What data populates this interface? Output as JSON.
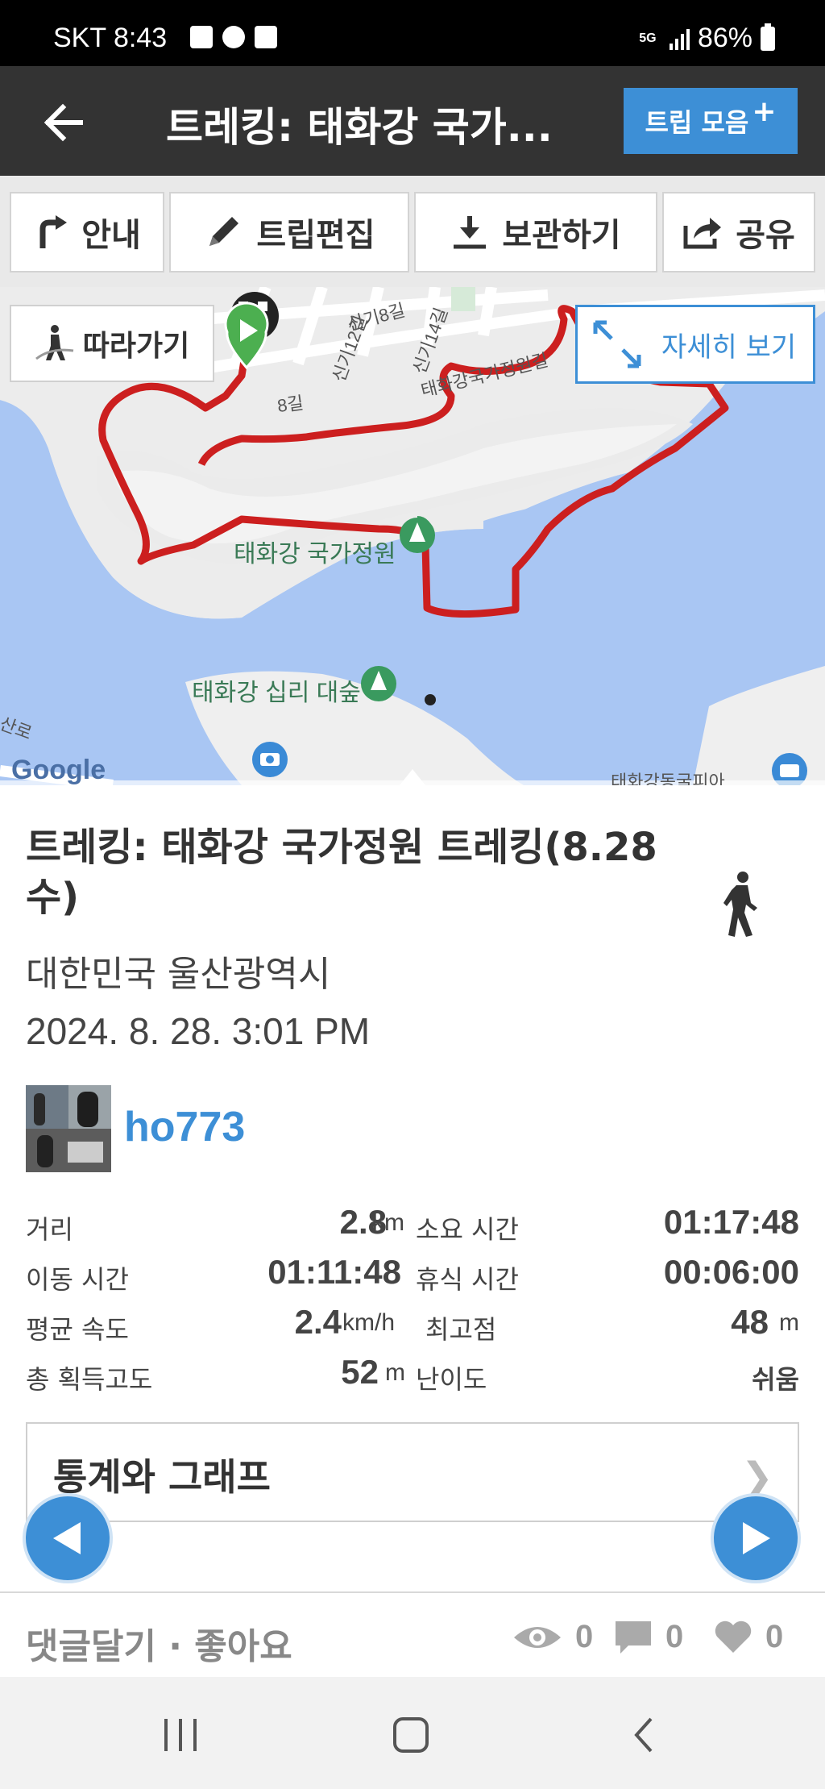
{
  "status_bar": {
    "carrier_time": "SKT 8:43",
    "network": "5G",
    "battery": "86%"
  },
  "header": {
    "title": "트레킹: 태화강 국가...",
    "trip_collection": "트립 모음"
  },
  "actions": {
    "guide": "안내",
    "edit": "트립편집",
    "save": "보관하기",
    "share": "공유"
  },
  "map": {
    "follow": "따라가기",
    "detail": "자세히 보기",
    "labels": {
      "garden": "태화강 국가정원",
      "forest": "태화강 십리 대숲",
      "road_garden": "태화강국가정원길",
      "road_sin8": "신기8길",
      "road_sin12": "신기12길",
      "road_sin14": "신기14길",
      "road_8gil": "8길",
      "road_left": "산로",
      "bottom_right": "태화강동굴피아"
    },
    "google": "Google"
  },
  "trip": {
    "title": "트레킹: 태화강 국가정원  트레킹(8.28 수)",
    "location": "대한민국 울산광역시",
    "datetime": "2024. 8. 28. 3:01 PM",
    "user": "ho773",
    "activity_icon": "walking-icon"
  },
  "stats": {
    "distance_label": "거리",
    "distance_value": "2.8",
    "distance_unit": "km",
    "duration_label": "소요 시간",
    "duration_value": "01:17:48",
    "moving_label": "이동 시간",
    "moving_value": "01:11:48",
    "rest_label": "휴식 시간",
    "rest_value": "00:06:00",
    "speed_label": "평균 속도",
    "speed_value": "2.4",
    "speed_unit": "km/h",
    "max_label": "최고점",
    "max_value": "48",
    "max_unit": "m",
    "gain_label": "총 획득고도",
    "gain_value": "52",
    "gain_unit": "m",
    "difficulty_label": "난이도",
    "difficulty_value": "쉬움"
  },
  "stats_graph": "통계와 그래프",
  "comments": {
    "label": "댓글달기 · 좋아요",
    "views": "0",
    "comments": "0",
    "likes": "0"
  },
  "colors": {
    "accent": "#3d8fd6",
    "header_bg": "#333333",
    "route": "#cc1f1f",
    "water": "#a9c6f3"
  }
}
